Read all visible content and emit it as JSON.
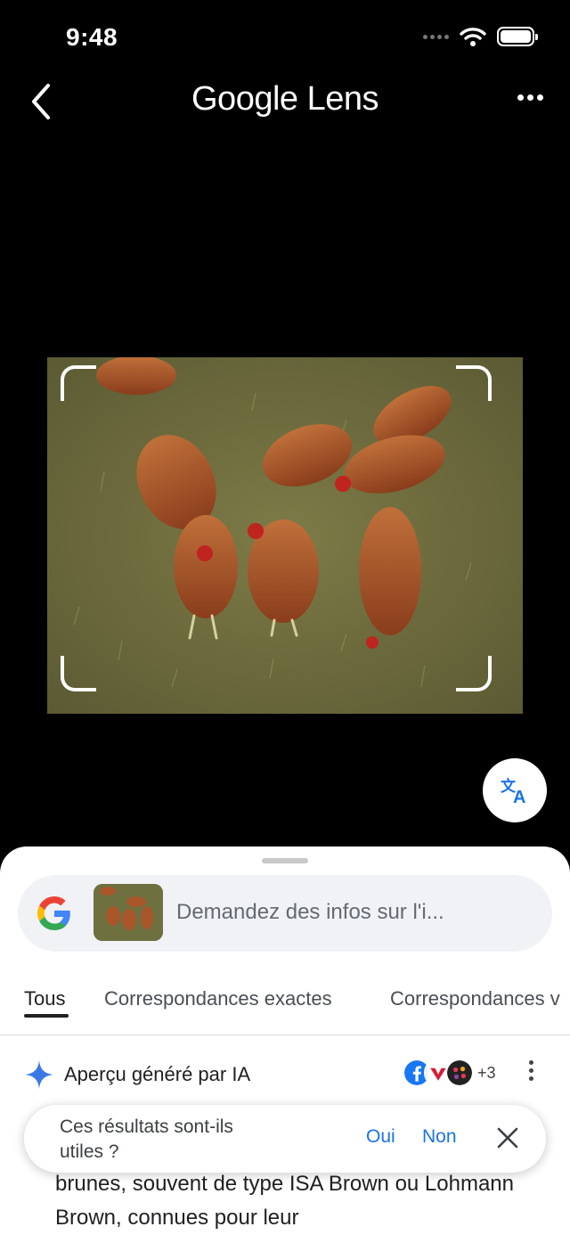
{
  "status_bar": {
    "time": "9:48"
  },
  "header": {
    "title": "Google Lens"
  },
  "search": {
    "placeholder": "Demandez des infos sur l'i..."
  },
  "tabs": [
    {
      "label": "Tous",
      "active": true
    },
    {
      "label": "Correspondances exactes",
      "active": false
    },
    {
      "label": "Correspondances v",
      "active": false
    }
  ],
  "ai_overview": {
    "label": "Aperçu généré par IA",
    "source_count": "+3"
  },
  "feedback": {
    "question": "Ces résultats sont-ils utiles ?",
    "yes_label": "Oui",
    "no_label": "Non"
  },
  "result_text": "brunes, souvent de type ISA Brown ou Lohmann Brown, connues pour leur",
  "colors": {
    "accent_blue": "#1a73e8",
    "sheet_bg": "#ffffff",
    "pill_bg": "#f0f2f5"
  }
}
